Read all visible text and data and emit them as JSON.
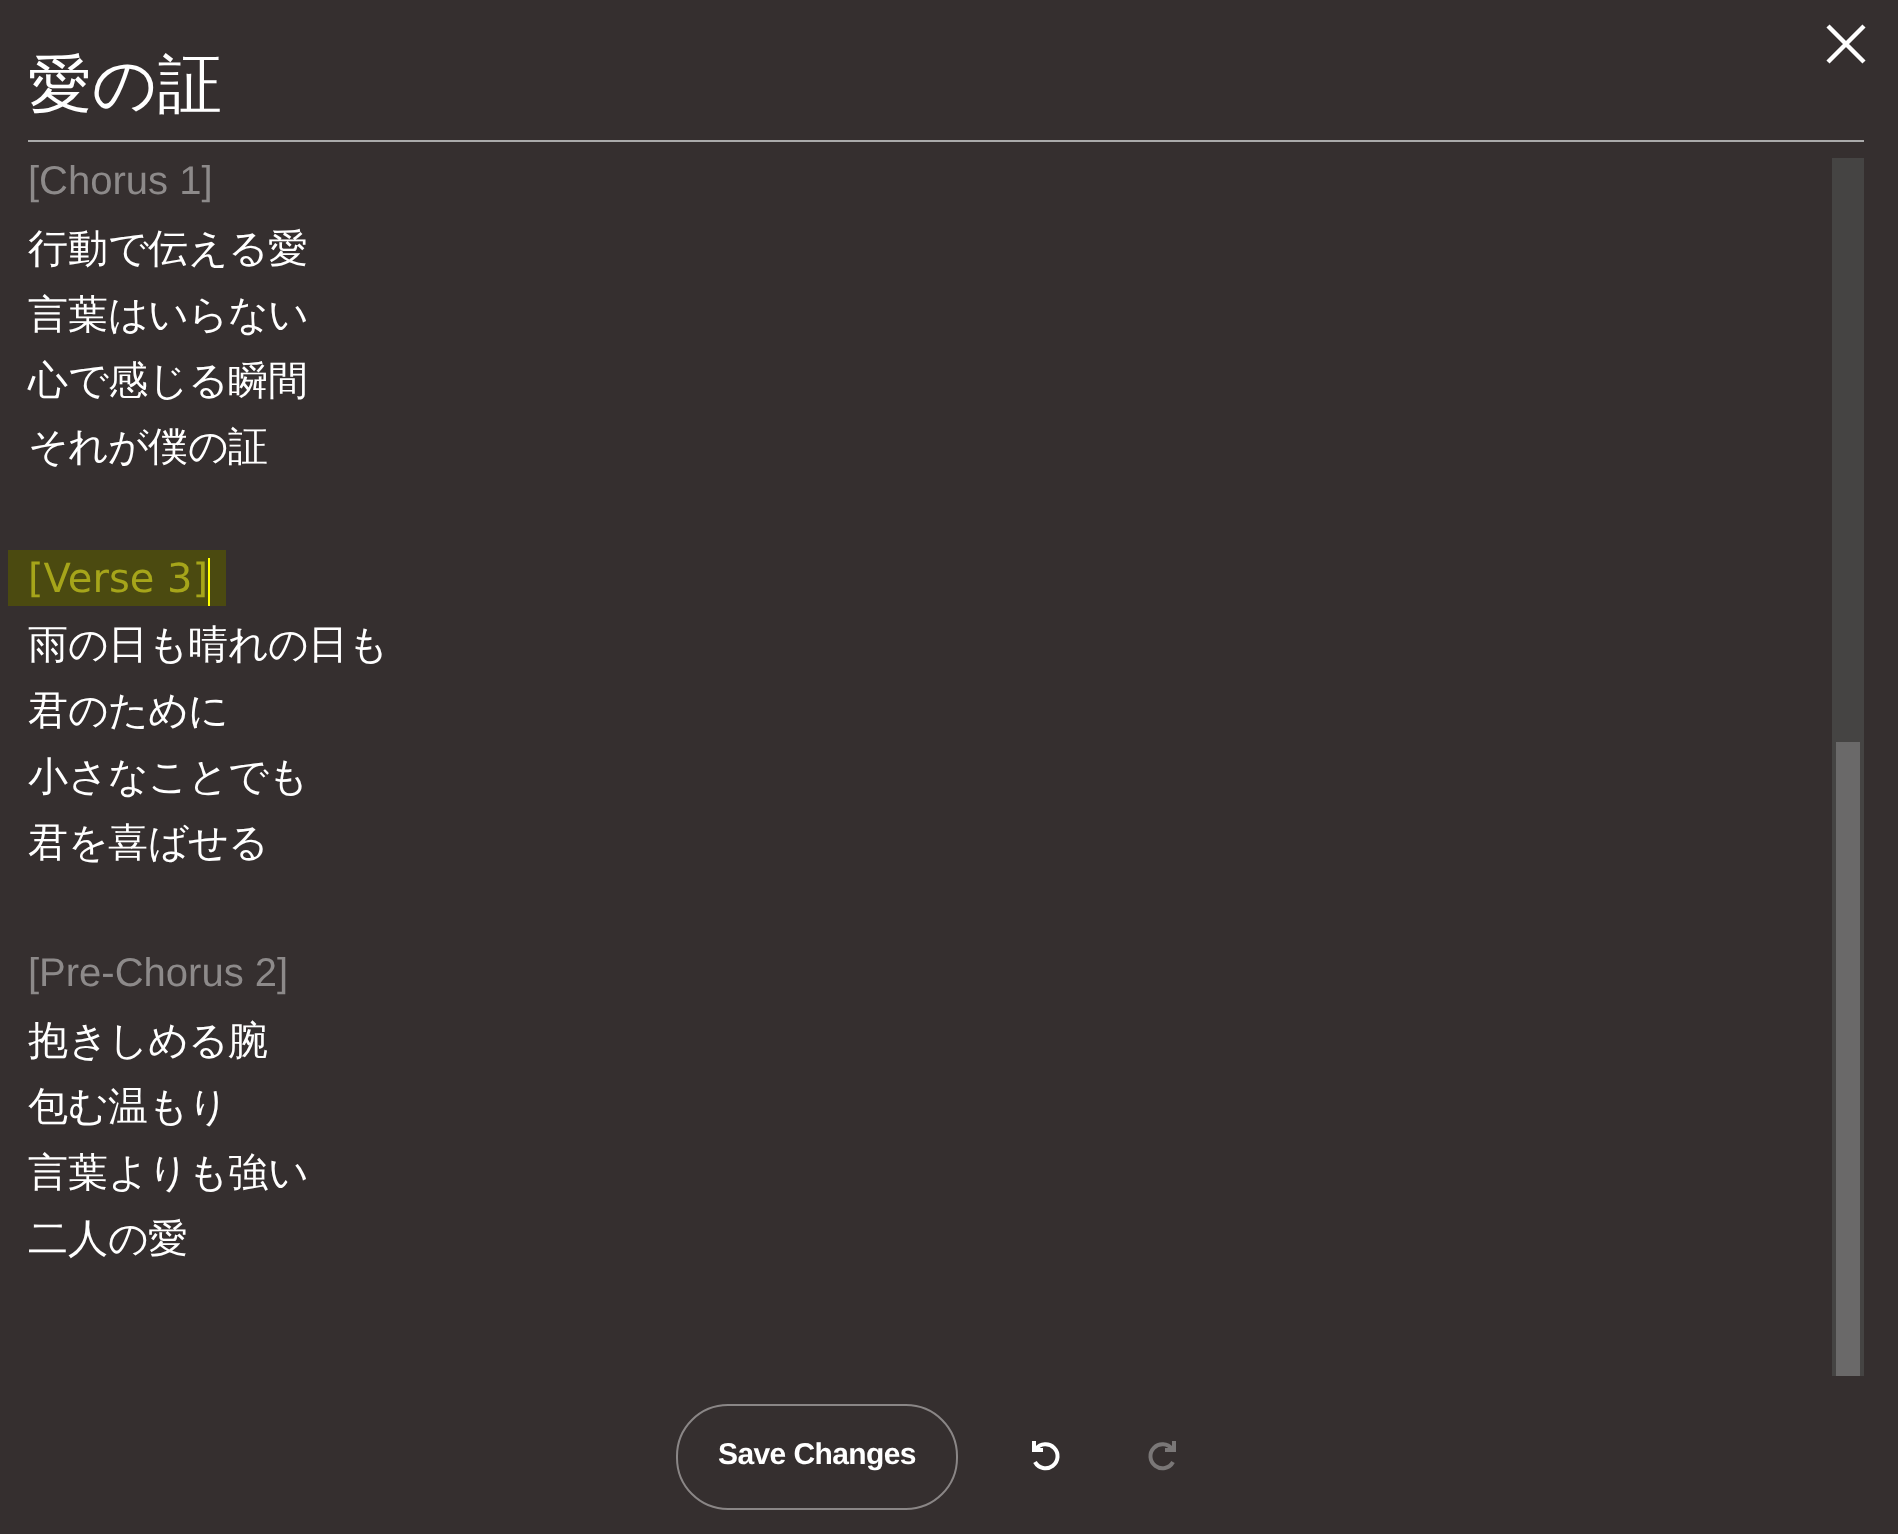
{
  "title": "愛の証",
  "lines": [
    {
      "kind": "section",
      "text": "[Chorus 1]",
      "highlighted": false
    },
    {
      "kind": "lyric",
      "text": "行動で伝える愛"
    },
    {
      "kind": "lyric",
      "text": "言葉はいらない"
    },
    {
      "kind": "lyric",
      "text": "心で感じる瞬間"
    },
    {
      "kind": "lyric",
      "text": "それが僕の証"
    },
    {
      "kind": "blank"
    },
    {
      "kind": "section",
      "text": "[Verse 3]",
      "highlighted": true
    },
    {
      "kind": "lyric",
      "text": "雨の日も晴れの日も"
    },
    {
      "kind": "lyric",
      "text": "君のために"
    },
    {
      "kind": "lyric",
      "text": "小さなことでも"
    },
    {
      "kind": "lyric",
      "text": "君を喜ばせる"
    },
    {
      "kind": "blank"
    },
    {
      "kind": "section",
      "text": "[Pre-Chorus 2]",
      "highlighted": false
    },
    {
      "kind": "lyric",
      "text": "抱きしめる腕"
    },
    {
      "kind": "lyric",
      "text": "包む温もり"
    },
    {
      "kind": "lyric",
      "text": "言葉よりも強い"
    },
    {
      "kind": "lyric",
      "text": "二人の愛"
    }
  ],
  "save_button": "Save Changes",
  "undo": {
    "disabled": false
  },
  "redo": {
    "disabled": true
  }
}
